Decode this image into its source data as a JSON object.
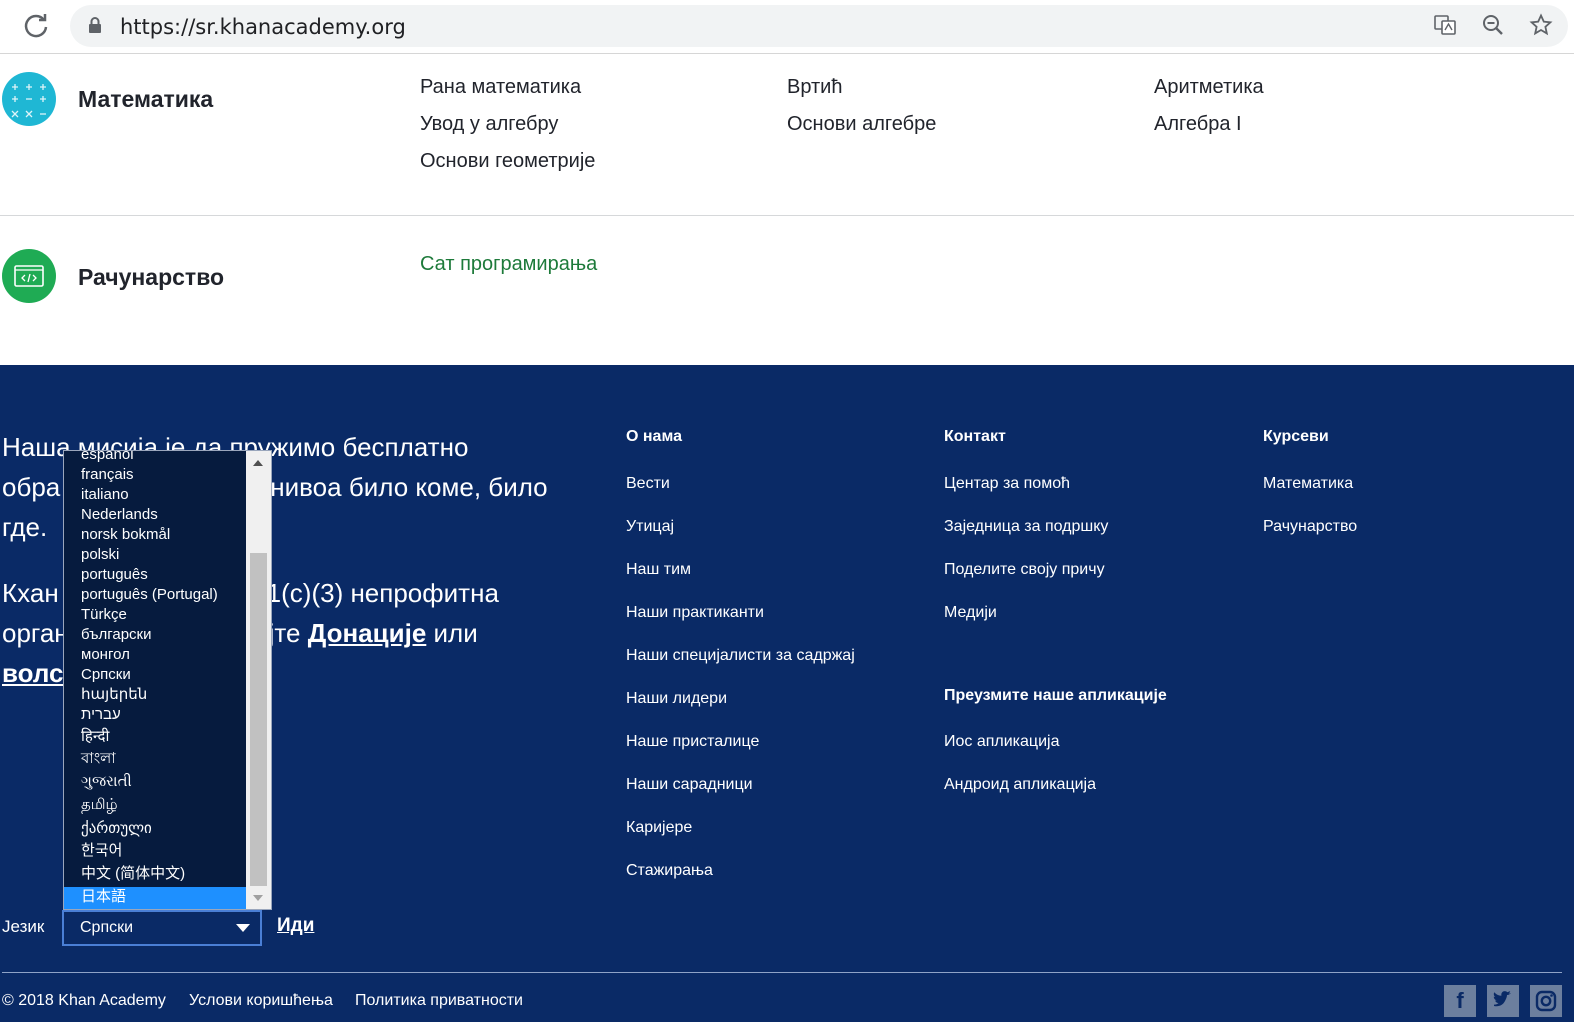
{
  "browser": {
    "url": "https://sr.khanacademy.org"
  },
  "subjects": [
    {
      "title": "Математика",
      "courses": [
        "Рана математика",
        "Вртић",
        "Аритметика",
        "Увод у алгебру",
        "Основи алгебре",
        "Алгебра I",
        "Основи геометрије"
      ]
    },
    {
      "title": "Рачунарство",
      "courses": [
        "Сат програмирања"
      ]
    }
  ],
  "colors": {
    "footer_bg": "#0a2a66",
    "math_icon": "#1fb7d4",
    "cs_icon": "#1fab54",
    "cs_link": "#1d7a3a",
    "selected_option": "#1e90ff"
  },
  "footer": {
    "mission_line1": "Наша мисија је да пружимо бесплатно",
    "mission_line2": "обра",
    "mission_line2b": "нивоа било коме, било",
    "mission_line3": "где.",
    "nonprofit_line1a": "Кхан",
    "nonprofit_line1b": "1(c)(3) непрофитна",
    "nonprofit_line2a": "орган",
    "nonprofit_line2b": "јте",
    "donate_link": "Донације",
    "nonprofit_line2c": "или",
    "volunteer_link": "волс",
    "about": {
      "heading": "О нама",
      "links": [
        "Вести",
        "Утицај",
        "Наш тим",
        "Наши практиканти",
        "Наши специјалисти за садржај",
        "Наши лидери",
        "Наше присталице",
        "Наши сарадници",
        "Каријере",
        "Стажирања"
      ]
    },
    "contact": {
      "heading": "Контакт",
      "links": [
        "Центар за помоћ",
        "Заједница за подршку",
        "Поделите своју причу",
        "Медији"
      ]
    },
    "apps": {
      "heading": "Преузмите наше апликације",
      "links": [
        "Иос апликација",
        "Андроид апликација"
      ]
    },
    "courses": {
      "heading": "Курсеви",
      "links": [
        "Математика",
        "Рачунарство"
      ]
    },
    "language_label": "Језик",
    "language_selected": "Српски",
    "go_label": "Иди",
    "copyright": "© 2018 Khan Academy",
    "terms": "Услови коришћења",
    "privacy": "Политика приватности"
  },
  "language_options": [
    "español",
    "français",
    "italiano",
    "Nederlands",
    "norsk bokmål",
    "polski",
    "português",
    "português (Portugal)",
    "Türkçe",
    "български",
    "монгол",
    "Српски",
    "հայերեն",
    "עברית",
    "हिन्दी",
    "বাংলা",
    "ગુજરાતી",
    "தமிழ்",
    "ქართული",
    "한국어",
    "中文 (简体中文)",
    "日本語"
  ],
  "language_highlighted": "日本語",
  "social": [
    "facebook-icon",
    "twitter-icon",
    "instagram-icon"
  ]
}
